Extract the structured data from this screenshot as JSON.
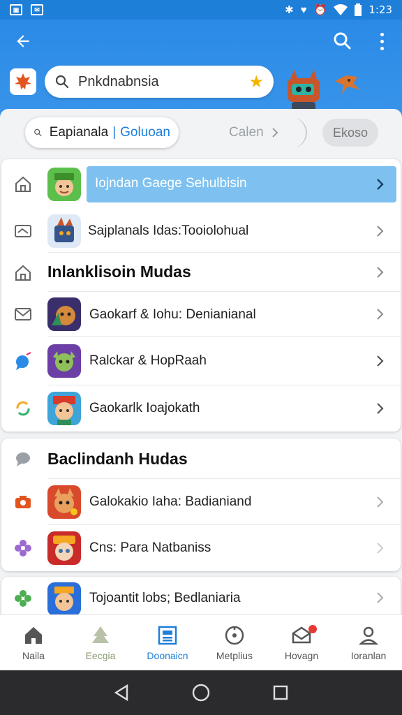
{
  "status_bar": {
    "time": "1:23"
  },
  "search": {
    "value": "Pnkdnabnsia"
  },
  "chips": {
    "active_a": "Eapianala",
    "active_sep": "|",
    "active_b": "Goluoan",
    "next_label": "Calen",
    "other_label": "Ekoso"
  },
  "section1": {
    "rows": [
      {
        "label": "Iojndan Gaege Sehulbisin"
      },
      {
        "label": "Sajplanals Idas:Tooiolohual"
      },
      {
        "label": "Inlanklisoin Mudas"
      },
      {
        "label": "Gaokarf & Iohu: Denianianal"
      },
      {
        "label": "Ralckar & HopRaah"
      },
      {
        "label": "Gaokarlk Ioajokath"
      }
    ]
  },
  "section2": {
    "heading": "Baclindanh Hudas",
    "rows": [
      {
        "label": "Galokakio Iaha: Badianiand"
      },
      {
        "label": "Cns: Para Natbaniss"
      }
    ]
  },
  "section3": {
    "rows": [
      {
        "label": "Tojoantit lobs; Bedlaniaria"
      }
    ]
  },
  "bottom_nav": [
    {
      "label": "Naila"
    },
    {
      "label": "Eecgia"
    },
    {
      "label": "Doonaicn"
    },
    {
      "label": "Metplius"
    },
    {
      "label": "Hovagn"
    },
    {
      "label": "Ioranlan"
    }
  ],
  "colors": {
    "primary": "#1e7fd9",
    "highlight": "#7ec1f0",
    "badge": "#e53935"
  }
}
